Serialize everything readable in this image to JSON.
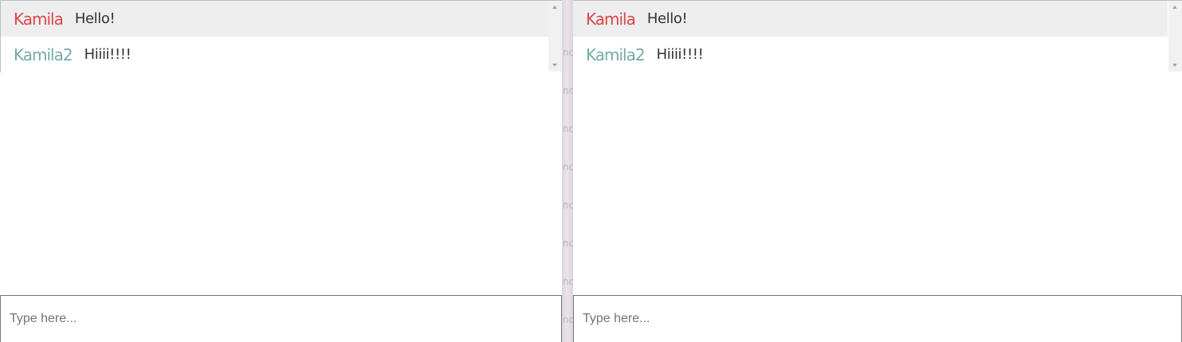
{
  "colors": {
    "user_primary": "#d94848",
    "user_secondary": "#75aaa8",
    "row_highlight": "#eeeeee",
    "divider_text": "#c2afc6"
  },
  "windows": [
    {
      "messages": [
        {
          "username": "Kamila",
          "text": "Hello!"
        },
        {
          "username": "Kamila2",
          "text": "Hiiii!!!!"
        }
      ],
      "input": {
        "value": "",
        "placeholder": "Type here..."
      }
    },
    {
      "messages": [
        {
          "username": "Kamila",
          "text": "Hello!"
        },
        {
          "username": "Kamila2",
          "text": "Hiiii!!!!"
        }
      ],
      "input": {
        "value": "",
        "placeholder": "Type here..."
      }
    }
  ],
  "divider": {
    "text": "no"
  },
  "icons": {
    "scroll_up": "triangle-up",
    "scroll_down": "triangle-down"
  }
}
